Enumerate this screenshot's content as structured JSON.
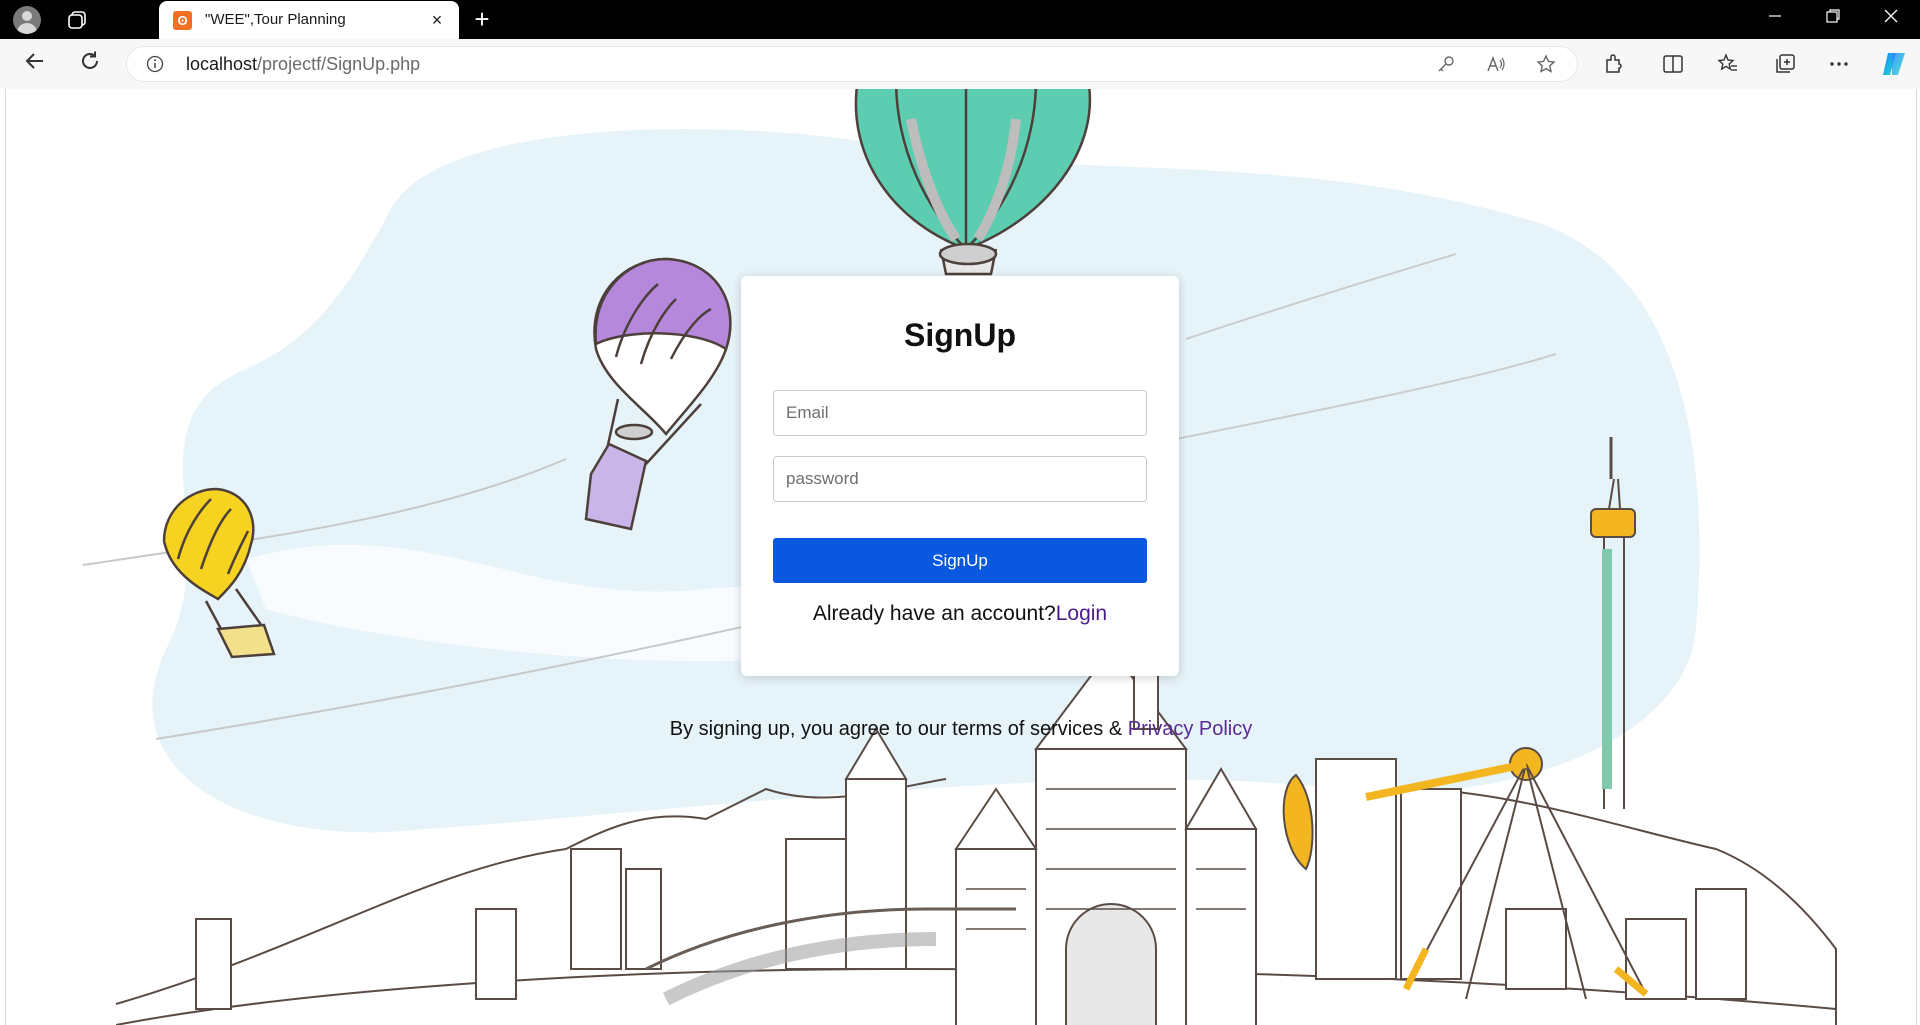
{
  "browser": {
    "tab_title": "\"WEE\",Tour Planning",
    "tab_favicon": "xampp-icon",
    "url_host": "localhost",
    "url_path": "/projectf/SignUp.php",
    "new_tab_symbol": "+",
    "close_tab_symbol": "×"
  },
  "signup": {
    "title": "SignUp",
    "email_placeholder": "Email",
    "password_placeholder": "password",
    "button_label": "SignUp",
    "login_prompt": "Already have an account?",
    "login_link": "Login"
  },
  "footer": {
    "terms_text": "By signing up, you agree to our terms of services & ",
    "privacy_link": "Privacy Policy"
  },
  "colors": {
    "primary_button": "#0a58e0",
    "link": "#4b1d8c",
    "sky_wash": "#e6f4fa"
  }
}
